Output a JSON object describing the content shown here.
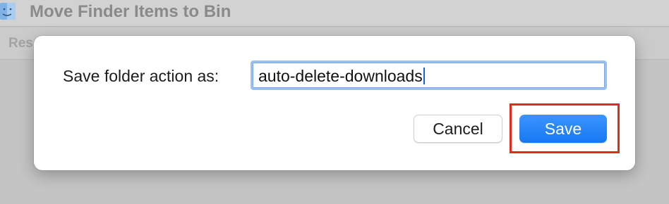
{
  "window": {
    "title": "Move Finder Items to Bin",
    "subbar_label": "Res"
  },
  "dialog": {
    "field_label": "Save folder action as:",
    "input_value": "auto-delete-downloads",
    "cancel_label": "Cancel",
    "save_label": "Save"
  },
  "colors": {
    "accent": "#1678f2",
    "highlight": "#e02b1f",
    "focus_ring": "#9cc1f0"
  },
  "icons": {
    "app": "finder-icon"
  }
}
